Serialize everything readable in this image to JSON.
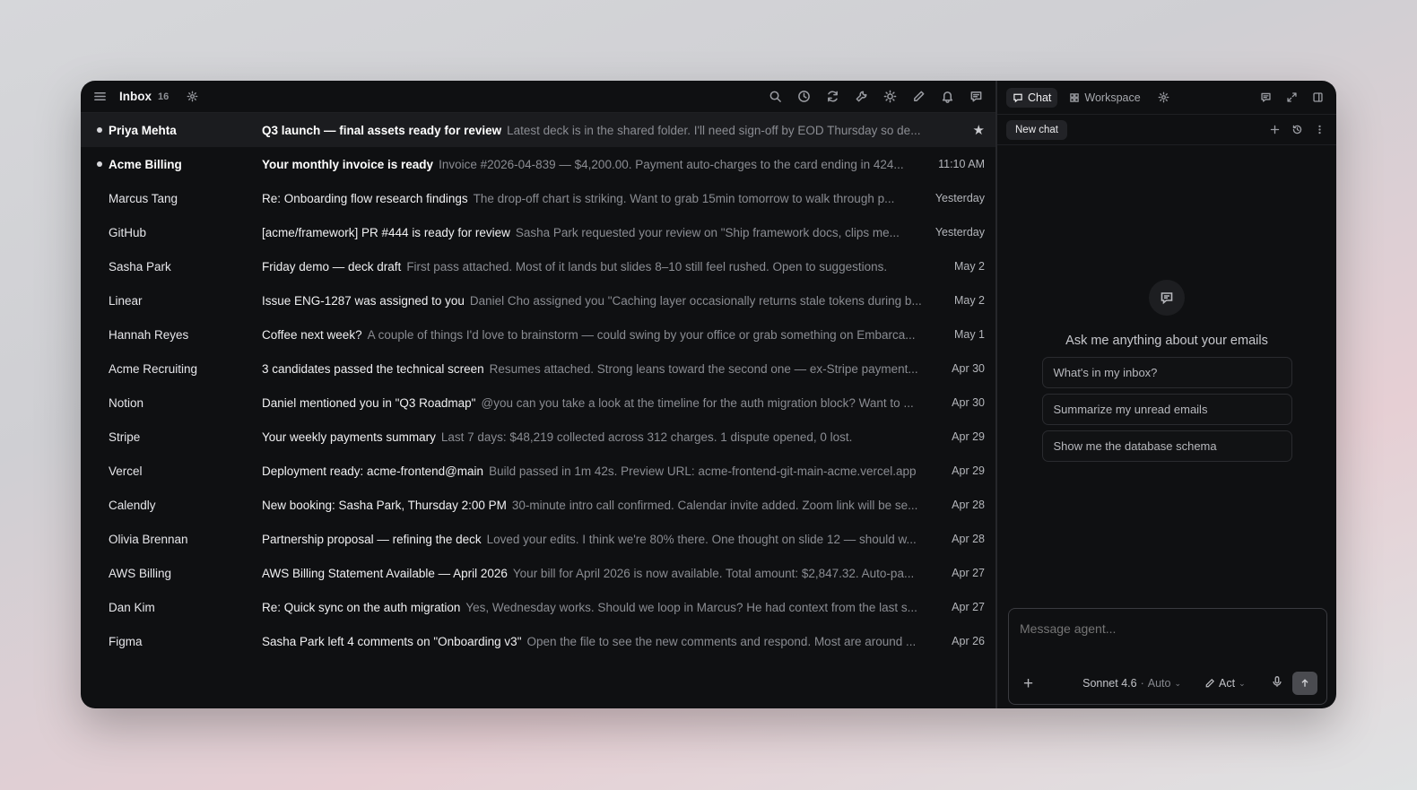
{
  "inbox": {
    "title": "Inbox",
    "count": "16",
    "emails": [
      {
        "sender": "Priya Mehta",
        "subject": "Q3 launch — final assets ready for review",
        "preview": "Latest deck is in the shared folder. I'll need sign-off by EOD Thursday so de...",
        "date": "",
        "unread": true,
        "starred": true,
        "selected": true
      },
      {
        "sender": "Acme Billing",
        "subject": "Your monthly invoice is ready",
        "preview": "Invoice #2026-04-839 — $4,200.00. Payment auto-charges to the card ending in 424...",
        "date": "11:10 AM",
        "unread": true
      },
      {
        "sender": "Marcus Tang",
        "subject": "Re: Onboarding flow research findings",
        "preview": "The drop-off chart is striking. Want to grab 15min tomorrow to walk through p...",
        "date": "Yesterday"
      },
      {
        "sender": "GitHub",
        "subject": "[acme/framework] PR #444 is ready for review",
        "preview": "Sasha Park requested your review on \"Ship framework docs, clips me...",
        "date": "Yesterday"
      },
      {
        "sender": "Sasha Park",
        "subject": "Friday demo — deck draft",
        "preview": "First pass attached. Most of it lands but slides 8–10 still feel rushed. Open to suggestions.",
        "date": "May 2"
      },
      {
        "sender": "Linear",
        "subject": "Issue ENG-1287 was assigned to you",
        "preview": "Daniel Cho assigned you \"Caching layer occasionally returns stale tokens during b...",
        "date": "May 2"
      },
      {
        "sender": "Hannah Reyes",
        "subject": "Coffee next week?",
        "preview": "A couple of things I'd love to brainstorm — could swing by your office or grab something on Embarca...",
        "date": "May 1"
      },
      {
        "sender": "Acme Recruiting",
        "subject": "3 candidates passed the technical screen",
        "preview": "Resumes attached. Strong leans toward the second one — ex-Stripe payment...",
        "date": "Apr 30"
      },
      {
        "sender": "Notion",
        "subject": "Daniel mentioned you in \"Q3 Roadmap\"",
        "preview": "@you can you take a look at the timeline for the auth migration block? Want to ...",
        "date": "Apr 30"
      },
      {
        "sender": "Stripe",
        "subject": "Your weekly payments summary",
        "preview": "Last 7 days: $48,219 collected across 312 charges. 1 dispute opened, 0 lost.",
        "date": "Apr 29"
      },
      {
        "sender": "Vercel",
        "subject": "Deployment ready: acme-frontend@main",
        "preview": "Build passed in 1m 42s. Preview URL: acme-frontend-git-main-acme.vercel.app",
        "date": "Apr 29"
      },
      {
        "sender": "Calendly",
        "subject": "New booking: Sasha Park, Thursday 2:00 PM",
        "preview": "30-minute intro call confirmed. Calendar invite added. Zoom link will be se...",
        "date": "Apr 28"
      },
      {
        "sender": "Olivia Brennan",
        "subject": "Partnership proposal — refining the deck",
        "preview": "Loved your edits. I think we're 80% there. One thought on slide 12 — should w...",
        "date": "Apr 28"
      },
      {
        "sender": "AWS Billing",
        "subject": "AWS Billing Statement Available — April 2026",
        "preview": "Your bill for April 2026 is now available. Total amount: $2,847.32. Auto-pa...",
        "date": "Apr 27"
      },
      {
        "sender": "Dan Kim",
        "subject": "Re: Quick sync on the auth migration",
        "preview": "Yes, Wednesday works. Should we loop in Marcus? He had context from the last s...",
        "date": "Apr 27"
      },
      {
        "sender": "Figma",
        "subject": "Sasha Park left 4 comments on \"Onboarding v3\"",
        "preview": "Open the file to see the new comments and respond. Most are around ...",
        "date": "Apr 26"
      }
    ]
  },
  "chat": {
    "tabs": [
      "Chat",
      "Workspace"
    ],
    "new_chat": "New chat",
    "empty_title": "Ask me anything about your emails",
    "suggestions": [
      "What's in my inbox?",
      "Summarize my unread emails",
      "Show me the database schema"
    ],
    "composer": {
      "placeholder": "Message agent...",
      "model": "Sonnet 4.6",
      "mode": "Auto",
      "action": "Act"
    }
  }
}
